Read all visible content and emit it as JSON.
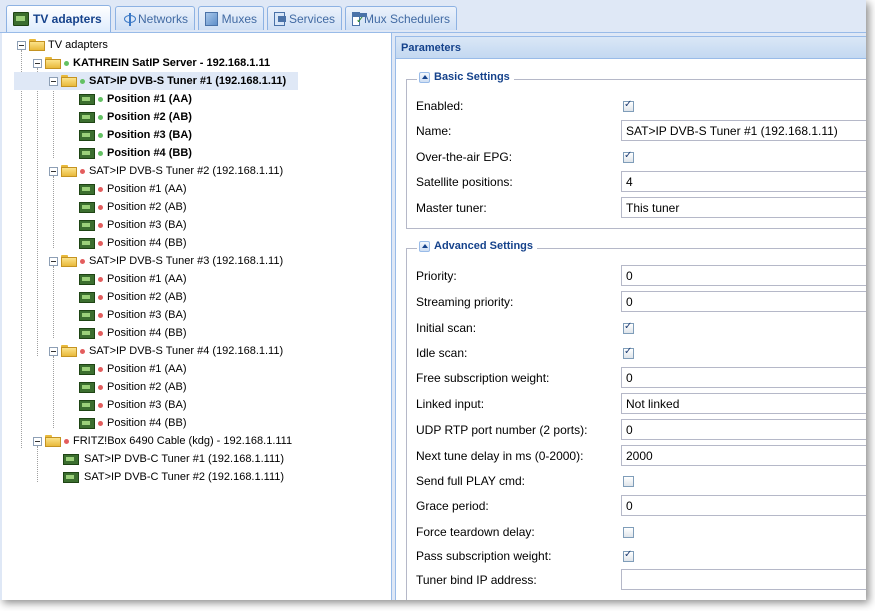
{
  "tabs": [
    {
      "label": "TV adapters",
      "icon": "tv-card-icon",
      "active": true
    },
    {
      "label": "Networks",
      "icon": "antenna-tower-icon",
      "active": false
    },
    {
      "label": "Muxes",
      "icon": "mux-icon",
      "active": false
    },
    {
      "label": "Services",
      "icon": "services-icon",
      "active": false
    },
    {
      "label": "Mux Schedulers",
      "icon": "scheduler-calendar-icon",
      "active": false
    }
  ],
  "tree": {
    "root": "TV adapters",
    "nodes": [
      {
        "label": "KATHREIN SatIP Server - 192.168.1.11",
        "level": 1,
        "type": "folder",
        "status": "green",
        "bold": true
      },
      {
        "label": "SAT>IP DVB-S Tuner #1 (192.168.1.11)",
        "level": 2,
        "type": "folder",
        "status": "green",
        "bold": true,
        "selected": true
      },
      {
        "label": "Position #1 (AA)",
        "level": 3,
        "type": "card",
        "status": "green",
        "bold": true
      },
      {
        "label": "Position #2 (AB)",
        "level": 3,
        "type": "card",
        "status": "green",
        "bold": true
      },
      {
        "label": "Position #3 (BA)",
        "level": 3,
        "type": "card",
        "status": "green",
        "bold": true
      },
      {
        "label": "Position #4 (BB)",
        "level": 3,
        "type": "card",
        "status": "green",
        "bold": true
      },
      {
        "label": "SAT>IP DVB-S Tuner #2 (192.168.1.11)",
        "level": 2,
        "type": "folder",
        "status": "red",
        "bold": false
      },
      {
        "label": "Position #1 (AA)",
        "level": 3,
        "type": "card",
        "status": "red",
        "bold": false
      },
      {
        "label": "Position #2 (AB)",
        "level": 3,
        "type": "card",
        "status": "red",
        "bold": false
      },
      {
        "label": "Position #3 (BA)",
        "level": 3,
        "type": "card",
        "status": "red",
        "bold": false
      },
      {
        "label": "Position #4 (BB)",
        "level": 3,
        "type": "card",
        "status": "red",
        "bold": false
      },
      {
        "label": "SAT>IP DVB-S Tuner #3 (192.168.1.11)",
        "level": 2,
        "type": "folder",
        "status": "red",
        "bold": false
      },
      {
        "label": "Position #1 (AA)",
        "level": 3,
        "type": "card",
        "status": "red",
        "bold": false
      },
      {
        "label": "Position #2 (AB)",
        "level": 3,
        "type": "card",
        "status": "red",
        "bold": false
      },
      {
        "label": "Position #3 (BA)",
        "level": 3,
        "type": "card",
        "status": "red",
        "bold": false
      },
      {
        "label": "Position #4 (BB)",
        "level": 3,
        "type": "card",
        "status": "red",
        "bold": false
      },
      {
        "label": "SAT>IP DVB-S Tuner #4 (192.168.1.11)",
        "level": 2,
        "type": "folder",
        "status": "red",
        "bold": false
      },
      {
        "label": "Position #1 (AA)",
        "level": 3,
        "type": "card",
        "status": "red",
        "bold": false
      },
      {
        "label": "Position #2 (AB)",
        "level": 3,
        "type": "card",
        "status": "red",
        "bold": false
      },
      {
        "label": "Position #3 (BA)",
        "level": 3,
        "type": "card",
        "status": "red",
        "bold": false
      },
      {
        "label": "Position #4 (BB)",
        "level": 3,
        "type": "card",
        "status": "red",
        "bold": false
      },
      {
        "label": "FRITZ!Box 6490 Cable (kdg) - 192.168.1.111",
        "level": 1,
        "type": "folder",
        "status": "red",
        "bold": false
      },
      {
        "label": "SAT>IP DVB-C Tuner #1 (192.168.1.111)",
        "level": 2,
        "type": "card",
        "status": "none",
        "bold": false
      },
      {
        "label": "SAT>IP DVB-C Tuner #2 (192.168.1.111)",
        "level": 2,
        "type": "card",
        "status": "none",
        "bold": false
      }
    ]
  },
  "panel": {
    "title": "Parameters",
    "basic": {
      "legend": "Basic Settings",
      "fields": [
        {
          "label": "Enabled:",
          "kind": "checkbox",
          "checked": true
        },
        {
          "label": "Name:",
          "kind": "text",
          "value": "SAT>IP DVB-S Tuner #1 (192.168.1.11)"
        },
        {
          "label": "Over-the-air EPG:",
          "kind": "checkbox",
          "checked": true
        },
        {
          "label": "Satellite positions:",
          "kind": "text",
          "value": "4"
        },
        {
          "label": "Master tuner:",
          "kind": "text",
          "value": "This tuner"
        }
      ]
    },
    "advanced": {
      "legend": "Advanced Settings",
      "fields": [
        {
          "label": "Priority:",
          "kind": "text",
          "value": "0"
        },
        {
          "label": "Streaming priority:",
          "kind": "text",
          "value": "0"
        },
        {
          "label": "Initial scan:",
          "kind": "checkbox",
          "checked": true
        },
        {
          "label": "Idle scan:",
          "kind": "checkbox",
          "checked": true
        },
        {
          "label": "Free subscription weight:",
          "kind": "text",
          "value": "0"
        },
        {
          "label": "Linked input:",
          "kind": "text",
          "value": "Not linked"
        },
        {
          "label": "UDP RTP port number (2 ports):",
          "kind": "text",
          "value": "0"
        },
        {
          "label": "Next tune delay in ms (0-2000):",
          "kind": "text",
          "value": "2000"
        },
        {
          "label": "Send full PLAY cmd:",
          "kind": "checkbox",
          "checked": false
        },
        {
          "label": "Grace period:",
          "kind": "text",
          "value": "0"
        },
        {
          "label": "Force teardown delay:",
          "kind": "checkbox",
          "checked": false
        },
        {
          "label": "Pass subscription weight:",
          "kind": "checkbox",
          "checked": true
        },
        {
          "label": "Tuner bind IP address:",
          "kind": "text",
          "value": ""
        }
      ]
    }
  }
}
